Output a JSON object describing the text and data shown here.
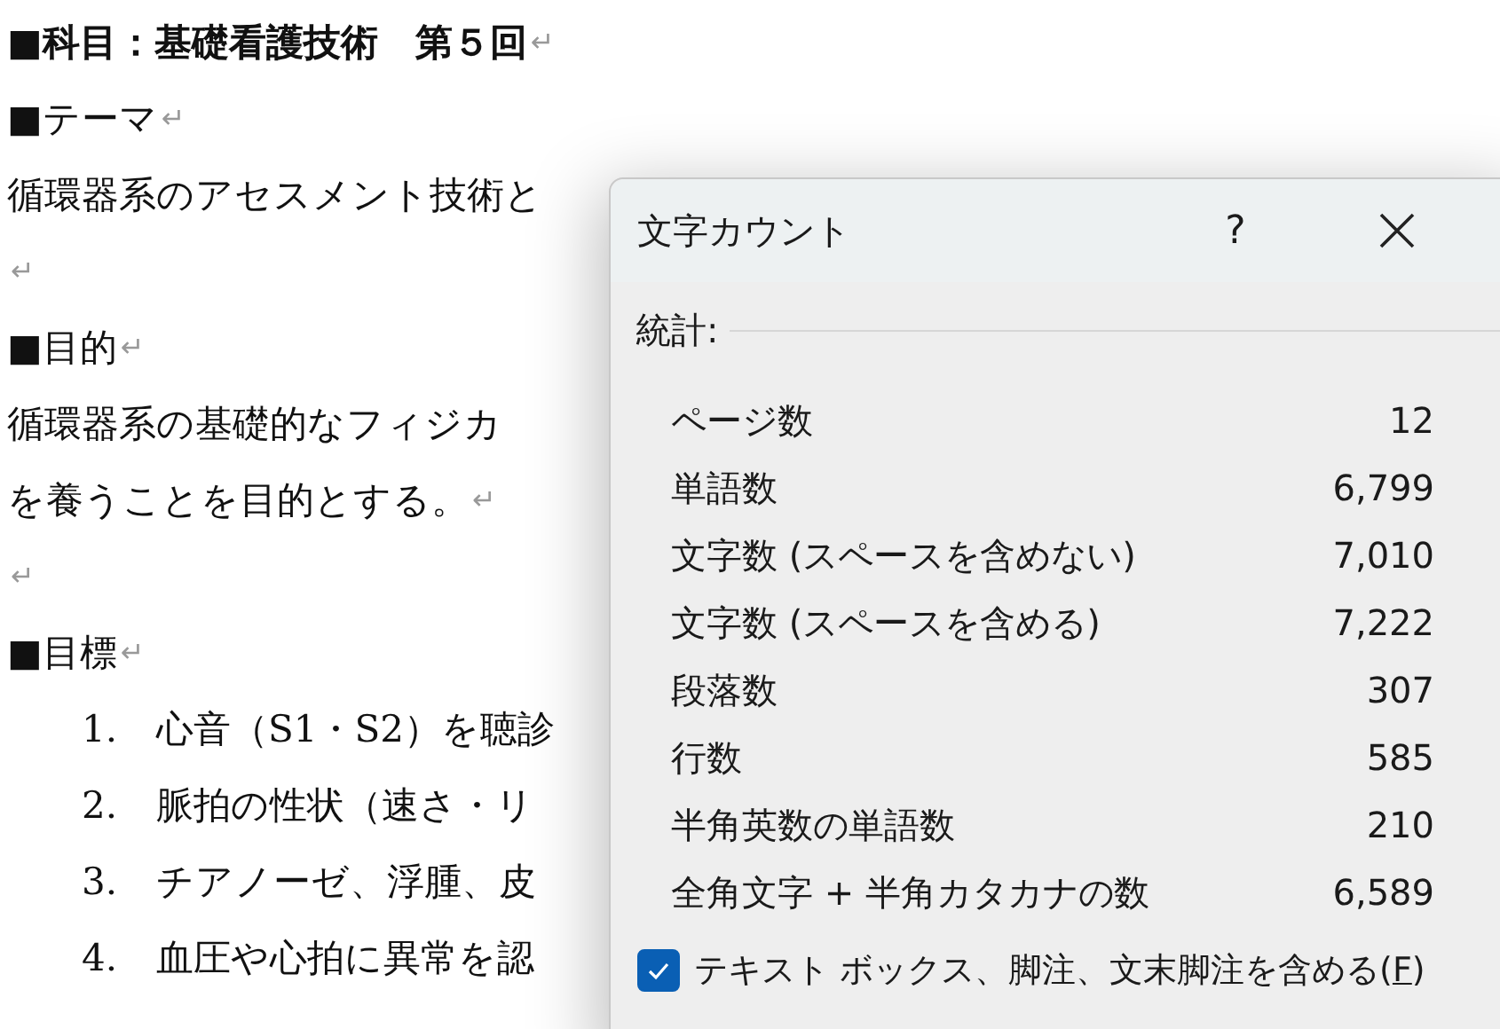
{
  "document": {
    "lines": [
      {
        "kind": "heading",
        "bullet": "■",
        "text": "科目：基礎看護技術　第５回",
        "mark": "↵",
        "bold": true
      },
      {
        "kind": "heading",
        "bullet": "■",
        "text": "テーマ",
        "mark": "↵",
        "bold": false
      },
      {
        "kind": "body",
        "text": "循環器系のアセスメント技術と"
      },
      {
        "kind": "blank",
        "mark": "↵"
      },
      {
        "kind": "heading",
        "bullet": "■",
        "text": "目的",
        "mark": "↵",
        "bold": false
      },
      {
        "kind": "body",
        "text": "循環器系の基礎的なフィジカ"
      },
      {
        "kind": "body",
        "text": "を養うことを目的とする。",
        "mark": "↵"
      },
      {
        "kind": "blank",
        "mark": "↵"
      },
      {
        "kind": "heading",
        "bullet": "■",
        "text": "目標",
        "mark": "↵",
        "bold": false
      },
      {
        "kind": "list",
        "number": "1.",
        "text": "心音（S1・S2）を聴診"
      },
      {
        "kind": "list",
        "number": "2.",
        "text": "脈拍の性状（速さ・リ"
      },
      {
        "kind": "list",
        "number": "3.",
        "text": "チアノーゼ、浮腫、皮"
      },
      {
        "kind": "list",
        "number": "4.",
        "text": "血圧や心拍に異常を認"
      }
    ]
  },
  "dialog": {
    "title": "文字カウント",
    "help": "?",
    "section": "統計:",
    "stats": [
      {
        "label": "ページ数",
        "value": "12"
      },
      {
        "label": "単語数",
        "value": "6,799"
      },
      {
        "label": "文字数 (スペースを含めない)",
        "value": "7,010"
      },
      {
        "label": "文字数 (スペースを含める)",
        "value": "7,222"
      },
      {
        "label": "段落数",
        "value": "307"
      },
      {
        "label": "行数",
        "value": "585"
      },
      {
        "label": "半角英数の単語数",
        "value": "210"
      },
      {
        "label": "全角文字 + 半角カタカナの数",
        "value": "6,589"
      }
    ],
    "option": {
      "label_before": "テキスト ボックス、脚注、文末脚注を含める(",
      "access_key": "F",
      "label_after": ")",
      "checked": true
    }
  }
}
